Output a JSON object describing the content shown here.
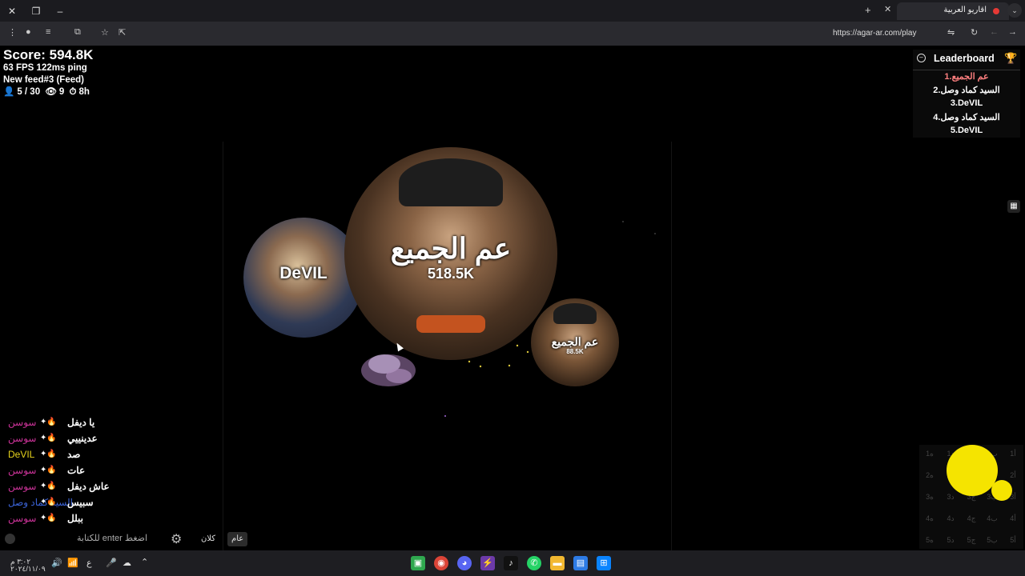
{
  "browser": {
    "tab_title": "اقاريو العربية",
    "url": "https://agar-ar.com/play",
    "new_tab": "+",
    "close": "✕"
  },
  "hud": {
    "score": "Score: 594.8K",
    "fps_ping": "63 FPS 122ms ping",
    "feed": "New feed#3 (Feed)",
    "players": "5 / 30",
    "spectators": "9",
    "time": "8h"
  },
  "leaderboard": {
    "title": "Leaderboard",
    "entries": [
      {
        "text": "عم الجميع.1",
        "color": "#ff8080"
      },
      {
        "text": "السيد كماد وصل.2",
        "color": "#ffffff"
      },
      {
        "text": "3.DeVIL",
        "color": "#ffffff"
      },
      {
        "text": "السيد كماد وصل.4",
        "color": "#ffffff"
      },
      {
        "text": "5.DeVIL",
        "color": "#ffffff"
      }
    ]
  },
  "cells": {
    "main": {
      "name": "عم الجميع",
      "mass": "518.5K"
    },
    "small": {
      "name": "عم الجميع",
      "mass": "88.5K"
    },
    "devil": {
      "name": "DeVIL"
    }
  },
  "chat": {
    "messages": [
      {
        "who": "سوسن",
        "who_color": "#cc3399",
        "msg": "يا ديفل"
      },
      {
        "who": "سوسن",
        "who_color": "#cc3399",
        "msg": "عدينييي"
      },
      {
        "who": "DeVIL",
        "who_color": "#e6d21c",
        "msg": "صد"
      },
      {
        "who": "سوسن",
        "who_color": "#cc3399",
        "msg": "عات"
      },
      {
        "who": "سوسن",
        "who_color": "#cc3399",
        "msg": "عاش ديفل"
      },
      {
        "who": "السيد كماد وصل",
        "who_color": "#3b63d6",
        "msg": "سبيس"
      },
      {
        "who": "سوسن",
        "who_color": "#cc3399",
        "msg": "ببلل"
      }
    ],
    "input_placeholder": "اضغط enter للكتابة",
    "tab_clan": "كلان",
    "tab_general": "عام"
  },
  "minimap": {
    "rows": [
      [
        "1ه",
        "1د",
        "1ج",
        "1ب",
        "1أ"
      ],
      [
        "2ه",
        "2د",
        "2ج",
        "2ب",
        "2أ"
      ],
      [
        "3ه",
        "3د",
        "3ج",
        "3ب",
        "3أ"
      ],
      [
        "4ه",
        "4د",
        "4ج",
        "4ب",
        "4أ"
      ],
      [
        "5ه",
        "5د",
        "5ج",
        "5ب",
        "5أ"
      ]
    ]
  },
  "taskbar": {
    "time": "٣:٠٢ م",
    "date": "٢٠٢٤/١١/٠٩",
    "lang": "ع"
  }
}
